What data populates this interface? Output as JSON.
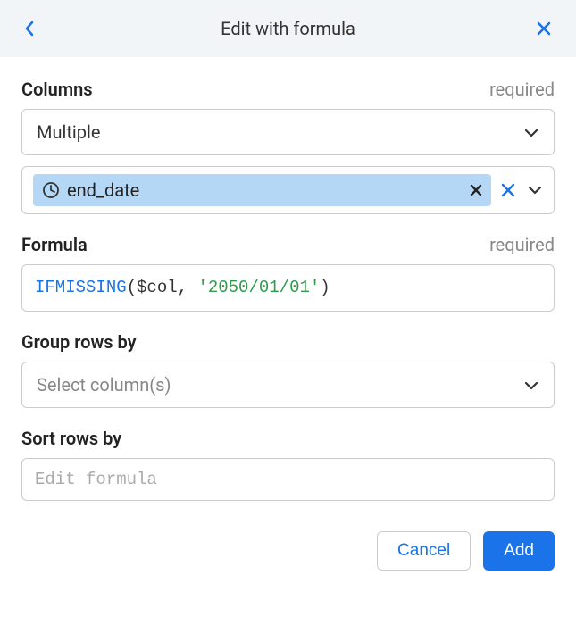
{
  "header": {
    "title": "Edit with formula"
  },
  "columns": {
    "label": "Columns",
    "required": "required",
    "mode": "Multiple",
    "selected": [
      {
        "name": "end_date",
        "icon": "clock"
      }
    ]
  },
  "formula": {
    "label": "Formula",
    "required": "required",
    "tokens": {
      "fn": "IFMISSING",
      "open": "(",
      "var": "$col",
      "comma": ", ",
      "str": "'2050/01/01'",
      "close": ")"
    },
    "raw": "IFMISSING($col, '2050/01/01')"
  },
  "group": {
    "label": "Group rows by",
    "placeholder": "Select column(s)"
  },
  "sort": {
    "label": "Sort rows by",
    "placeholder": "Edit formula"
  },
  "footer": {
    "cancel": "Cancel",
    "submit": "Add"
  }
}
